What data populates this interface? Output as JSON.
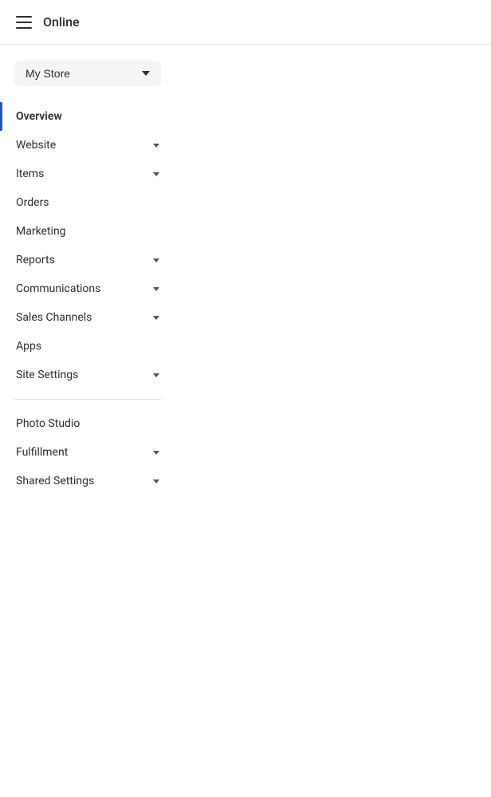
{
  "topbar": {
    "title": "Online"
  },
  "storeSelector": {
    "label": "My Store",
    "chevron": "chevron-down"
  },
  "nav": {
    "items": [
      {
        "id": "overview",
        "label": "Overview",
        "active": true,
        "hasChevron": false
      },
      {
        "id": "website",
        "label": "Website",
        "active": false,
        "hasChevron": true
      },
      {
        "id": "items",
        "label": "Items",
        "active": false,
        "hasChevron": true
      },
      {
        "id": "orders",
        "label": "Orders",
        "active": false,
        "hasChevron": false
      },
      {
        "id": "marketing",
        "label": "Marketing",
        "active": false,
        "hasChevron": false
      },
      {
        "id": "reports",
        "label": "Reports",
        "active": false,
        "hasChevron": true
      },
      {
        "id": "communications",
        "label": "Communications",
        "active": false,
        "hasChevron": true
      },
      {
        "id": "sales-channels",
        "label": "Sales Channels",
        "active": false,
        "hasChevron": true
      },
      {
        "id": "apps",
        "label": "Apps",
        "active": false,
        "hasChevron": false
      },
      {
        "id": "site-settings",
        "label": "Site Settings",
        "active": false,
        "hasChevron": true
      }
    ],
    "secondaryItems": [
      {
        "id": "photo-studio",
        "label": "Photo Studio",
        "active": false,
        "hasChevron": false
      },
      {
        "id": "fulfillment",
        "label": "Fulfillment",
        "active": false,
        "hasChevron": true
      },
      {
        "id": "shared-settings",
        "label": "Shared Settings",
        "active": false,
        "hasChevron": true
      }
    ]
  }
}
